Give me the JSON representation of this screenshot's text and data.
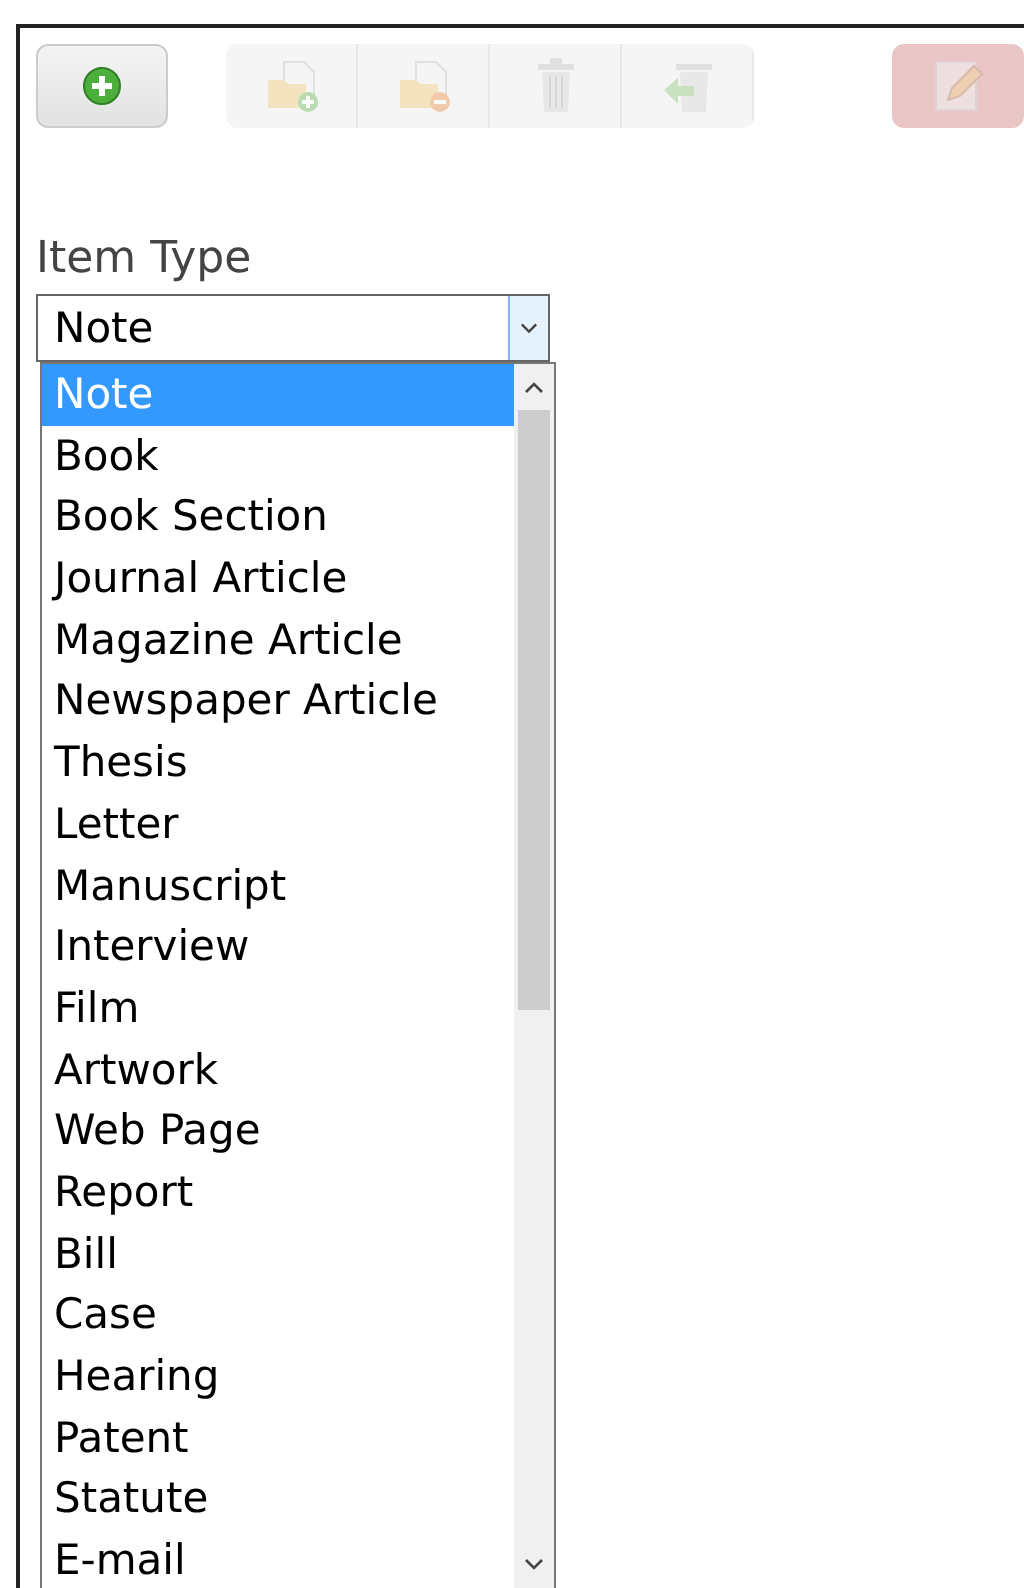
{
  "toolbar": {
    "buttons": [
      {
        "kind": "add",
        "disabled": false
      },
      {
        "kind": "folder-add",
        "disabled": true
      },
      {
        "kind": "folder-remove",
        "disabled": true
      },
      {
        "kind": "trash",
        "disabled": true
      },
      {
        "kind": "restore",
        "disabled": true
      },
      {
        "kind": "edit",
        "disabled": true
      }
    ]
  },
  "item_type": {
    "label": "Item Type",
    "value": "Note",
    "options": [
      {
        "label": "Note",
        "selected": true
      },
      {
        "label": "Book",
        "selected": false
      },
      {
        "label": "Book Section",
        "selected": false
      },
      {
        "label": "Journal Article",
        "selected": false
      },
      {
        "label": "Magazine Article",
        "selected": false
      },
      {
        "label": "Newspaper Article",
        "selected": false
      },
      {
        "label": "Thesis",
        "selected": false
      },
      {
        "label": "Letter",
        "selected": false
      },
      {
        "label": "Manuscript",
        "selected": false
      },
      {
        "label": "Interview",
        "selected": false
      },
      {
        "label": "Film",
        "selected": false
      },
      {
        "label": "Artwork",
        "selected": false
      },
      {
        "label": "Web Page",
        "selected": false
      },
      {
        "label": "Report",
        "selected": false
      },
      {
        "label": "Bill",
        "selected": false
      },
      {
        "label": "Case",
        "selected": false
      },
      {
        "label": "Hearing",
        "selected": false
      },
      {
        "label": "Patent",
        "selected": false
      },
      {
        "label": "Statute",
        "selected": false
      },
      {
        "label": "E-mail",
        "selected": false
      }
    ]
  }
}
